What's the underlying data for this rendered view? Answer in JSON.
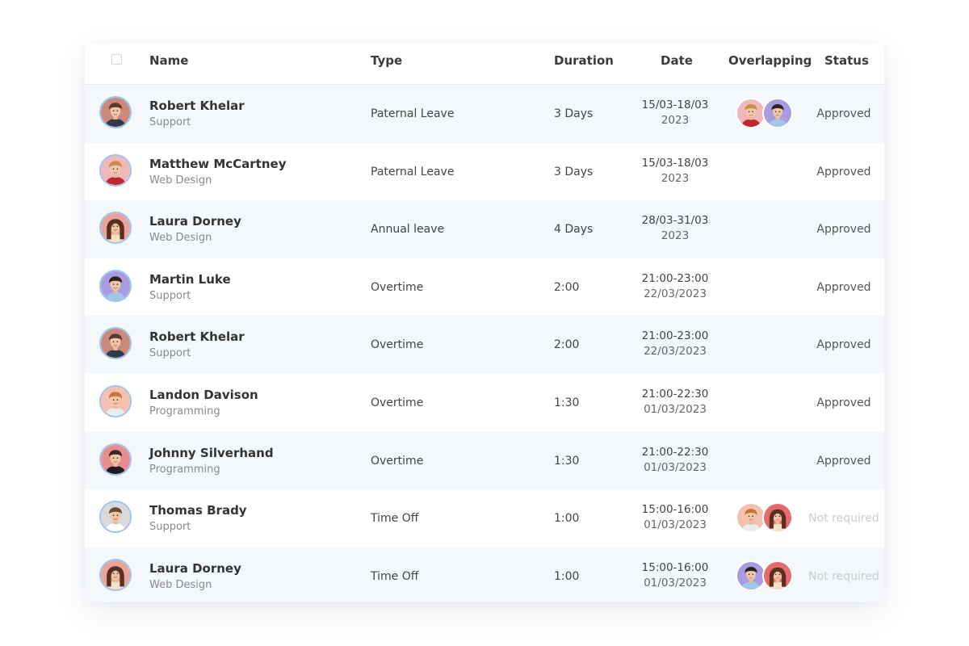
{
  "table": {
    "headers": {
      "name": "Name",
      "type": "Type",
      "duration": "Duration",
      "date": "Date",
      "overlapping": "Overlapping",
      "status": "Status"
    },
    "rows": [
      {
        "name": "Robert Khelar",
        "department": "Support",
        "type": "Paternal Leave",
        "duration": "3 Days",
        "date_line1": "15/03-18/03",
        "date_line2": "2023",
        "status": "Approved",
        "avatar_bg": "#c98a7c",
        "shirt": "#2f3a4a",
        "hair": "#5a3a2a",
        "overlap": [
          "avatar-red-shirt",
          "avatar-purple-bg"
        ]
      },
      {
        "name": "Matthew McCartney",
        "department": "Web Design",
        "type": "Paternal Leave",
        "duration": "3 Days",
        "date_line1": "15/03-18/03",
        "date_line2": "2023",
        "status": "Approved",
        "avatar_bg": "#f0b8b8",
        "shirt": "#c0262d",
        "hair": "#c98a4a",
        "overlap": []
      },
      {
        "name": "Laura Dorney",
        "department": "Web Design",
        "type": "Annual leave",
        "duration": "4 Days",
        "date_line1": "28/03-31/03",
        "date_line2": "2023",
        "status": "Approved",
        "avatar_bg": "#e7a49a",
        "shirt": "#f2e2c8",
        "hair": "#5b2f1e",
        "overlap": []
      },
      {
        "name": "Martin Luke",
        "department": "Support",
        "type": "Overtime",
        "duration": "2:00",
        "date_line1": "21:00-23:00",
        "date_line2": "22/03/2023",
        "status": "Approved",
        "avatar_bg": "#a99be0",
        "shirt": "#9fc6e8",
        "hair": "#2b2220",
        "overlap": []
      },
      {
        "name": "Robert Khelar",
        "department": "Support",
        "type": "Overtime",
        "duration": "2:00",
        "date_line1": "21:00-23:00",
        "date_line2": "22/03/2023",
        "status": "Approved",
        "avatar_bg": "#c98a7c",
        "shirt": "#2f3a4a",
        "hair": "#5a3a2a",
        "overlap": []
      },
      {
        "name": "Landon Davison",
        "department": "Programming",
        "type": "Overtime",
        "duration": "1:30",
        "date_line1": "21:00-22:30",
        "date_line2": "01/03/2023",
        "status": "Approved",
        "avatar_bg": "#f3c1ad",
        "shirt": "#e8ecef",
        "hair": "#c7743a",
        "overlap": []
      },
      {
        "name": "Johnny Silverhand",
        "department": "Programming",
        "type": "Overtime",
        "duration": "1:30",
        "date_line1": "21:00-22:30",
        "date_line2": "01/03/2023",
        "status": "Approved",
        "avatar_bg": "#e88d8d",
        "shirt": "#1d1d22",
        "hair": "#3a2a20",
        "overlap": []
      },
      {
        "name": "Thomas Brady",
        "department": "Support",
        "type": "Time Off",
        "duration": "1:00",
        "date_line1": "15:00-16:00",
        "date_line2": "01/03/2023",
        "status": "Not required",
        "avatar_bg": "#d9d9d9",
        "shirt": "#ffffff",
        "hair": "#6b4a34",
        "overlap": [
          "avatar-orange-hair",
          "avatar-woman-red"
        ]
      },
      {
        "name": "Laura Dorney",
        "department": "Web Design",
        "type": "Time Off",
        "duration": "1:00",
        "date_line1": "15:00-16:00",
        "date_line2": "01/03/2023",
        "status": "Not required",
        "avatar_bg": "#e7a49a",
        "shirt": "#f2e2c8",
        "hair": "#5b2f1e",
        "overlap": [
          "avatar-purple-bg",
          "avatar-woman-red"
        ]
      }
    ]
  },
  "colors": {
    "row_alt": "#f4f8fb",
    "avatar_ring": "#9ec3ea",
    "muted_status": "#c9ccd1"
  }
}
